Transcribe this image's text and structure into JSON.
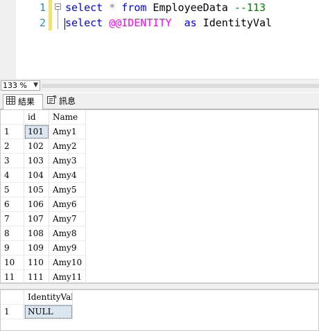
{
  "editor": {
    "line_numbers": [
      "1",
      "2"
    ],
    "line1": {
      "t1": "select",
      "t2": " * ",
      "t3": "from",
      "t4": " EmployeeData ",
      "t5": "--113"
    },
    "line2": {
      "t1": "select",
      "t2": " ",
      "t3": "@@IDENTITY",
      "t4": "  ",
      "t5": "as",
      "t6": " IdentityVal"
    },
    "colors": {
      "keyword": "#0000ff",
      "comment": "#008000",
      "system_var": "#ff00ff",
      "line_number": "#2b91af"
    }
  },
  "zoom": {
    "value": "133 %"
  },
  "tabs": {
    "results_label": "結果",
    "messages_label": "訊息",
    "results_icon": "grid-icon",
    "messages_icon": "message-icon"
  },
  "grid1": {
    "headers": {
      "id": "id",
      "name": "Name"
    },
    "rows": [
      {
        "num": "1",
        "id": "101",
        "name": "Amy1"
      },
      {
        "num": "2",
        "id": "102",
        "name": "Amy2"
      },
      {
        "num": "3",
        "id": "103",
        "name": "Amy3"
      },
      {
        "num": "4",
        "id": "104",
        "name": "Amy4"
      },
      {
        "num": "5",
        "id": "105",
        "name": "Amy5"
      },
      {
        "num": "6",
        "id": "106",
        "name": "Amy6"
      },
      {
        "num": "7",
        "id": "107",
        "name": "Amy7"
      },
      {
        "num": "8",
        "id": "108",
        "name": "Amy8"
      },
      {
        "num": "9",
        "id": "109",
        "name": "Amy9"
      },
      {
        "num": "10",
        "id": "110",
        "name": "Amy10"
      },
      {
        "num": "11",
        "id": "111",
        "name": "Amy11"
      }
    ]
  },
  "grid2": {
    "headers": {
      "val": "IdentityVal"
    },
    "rows": [
      {
        "num": "1",
        "val": "NULL"
      }
    ]
  }
}
